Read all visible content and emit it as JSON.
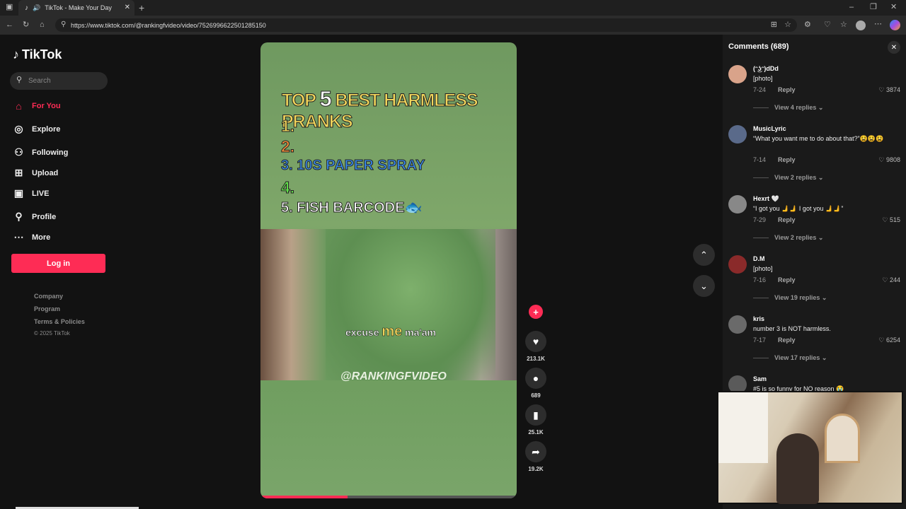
{
  "browser": {
    "tab_title": "TikTok - Make Your Day",
    "url": "https://www.tiktok.com/@rankingfvideo/video/7526996622501285150"
  },
  "sidebar": {
    "brand": "TikTok",
    "search_placeholder": "Search",
    "nav": [
      {
        "label": "For You",
        "icon": "home-icon",
        "active": true
      },
      {
        "label": "Explore",
        "icon": "compass-icon"
      },
      {
        "label": "Following",
        "icon": "following-icon"
      },
      {
        "label": "Upload",
        "icon": "upload-icon"
      },
      {
        "label": "LIVE",
        "icon": "live-icon"
      },
      {
        "label": "Profile",
        "icon": "profile-icon"
      },
      {
        "label": "More",
        "icon": "more-icon"
      }
    ],
    "login_label": "Log in",
    "footer": [
      "Company",
      "Program",
      "Terms & Policies"
    ],
    "copyright": "© 2025 TikTok"
  },
  "video": {
    "title_prefix": "TOP",
    "title_number": "5",
    "title_suffix": "BEST HARMLESS PRANKS",
    "list": [
      "1.",
      "2.",
      "3. 10S PAPER SPRAY",
      "4.",
      "5. FISH BARCODE🐟"
    ],
    "caption_pre": "excuse",
    "caption_big": "me",
    "caption_post": "ma'am",
    "watermark": "@RANKINGFVIDEO",
    "progress": 0.34
  },
  "actions": {
    "likes": "213.1K",
    "comments": "689",
    "saves": "25.1K",
    "shares": "19.2K"
  },
  "comments": {
    "header": "Comments (689)",
    "items": [
      {
        "user": "(ᵔ͜ʖᵔ)dDd",
        "text": "[photo]",
        "date": "7-24",
        "reply": "Reply",
        "likes": "3874",
        "view_replies": "View 4 replies"
      },
      {
        "user": "MusicLyric",
        "text": "“What you want me to do about that?”😫😫😫",
        "date": "7-14",
        "reply": "Reply",
        "likes": "9808",
        "view_replies": "View 2 replies"
      },
      {
        "user": "Hexrt 🤍",
        "text": "“I got you 🫸🫸 I got you 🫸🫸”",
        "date": "7-29",
        "reply": "Reply",
        "likes": "515",
        "view_replies": "View 2 replies"
      },
      {
        "user": "D.M",
        "text": "[photo]",
        "date": "7-16",
        "reply": "Reply",
        "likes": "244",
        "view_replies": "View 19 replies"
      },
      {
        "user": "kris",
        "text": "number 3 is NOT harmless.",
        "date": "7-17",
        "reply": "Reply",
        "likes": "6254",
        "view_replies": "View 17 replies"
      },
      {
        "user": "Sam",
        "text": "#5 is so funny for NO reason 😭",
        "date": "",
        "reply": "",
        "likes": "",
        "view_replies": ""
      }
    ]
  },
  "colors": {
    "accent": "#fe2c55",
    "background": "#121212",
    "panel": "#1a1a1a"
  }
}
